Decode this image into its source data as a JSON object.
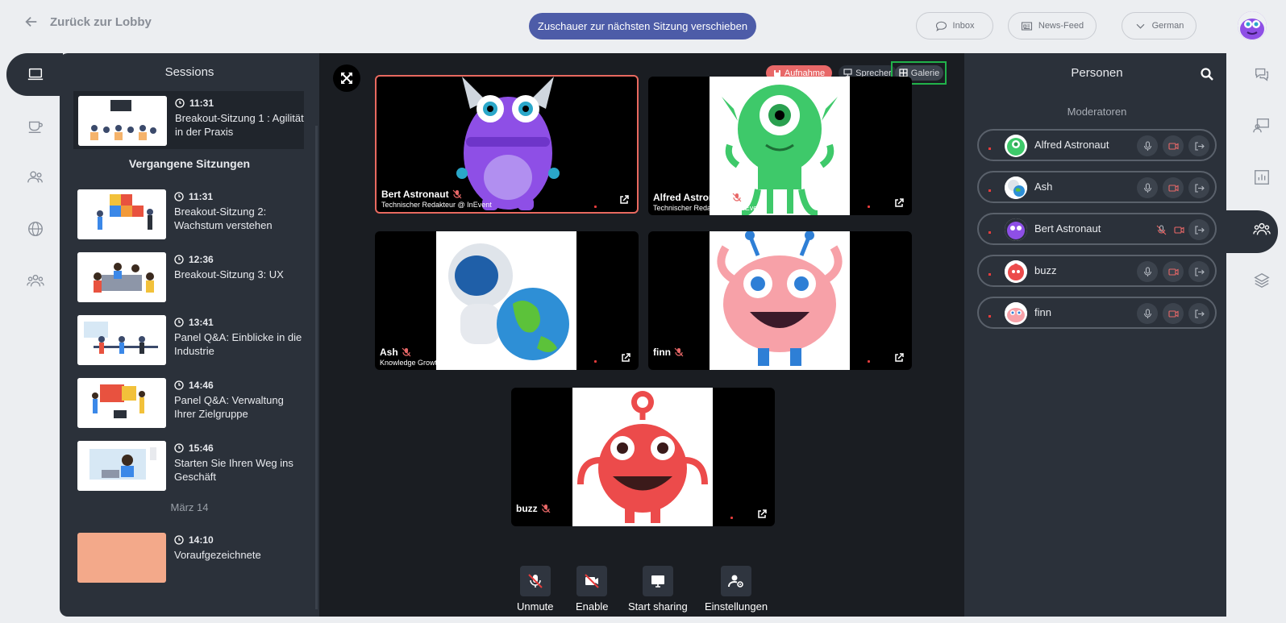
{
  "topbar": {
    "back_label": "Zurück zur Lobby",
    "move_button": "Zuschauer zur nächsten Sitzung verschieben",
    "inbox": "Inbox",
    "newsfeed": "News-Feed",
    "language": "German"
  },
  "sessions": {
    "title": "Sessions",
    "current": {
      "time": "11:31",
      "name": "Breakout-Sitzung 1 : Agilität in der Praxis"
    },
    "past_heading": "Vergangene Sitzungen",
    "past": [
      {
        "time": "11:31",
        "name": "Breakout-Sitzung 2: Wachstum verstehen"
      },
      {
        "time": "12:36",
        "name": "Breakout-Sitzung 3: UX"
      },
      {
        "time": "13:41",
        "name": "Panel Q&A: Einblicke in die Industrie"
      },
      {
        "time": "14:46",
        "name": "Panel Q&A: Verwaltung Ihrer Zielgruppe"
      },
      {
        "time": "15:46",
        "name": "Starten Sie Ihren Weg ins Geschäft"
      }
    ],
    "date_label": "März 14",
    "later": {
      "time": "14:10",
      "name": "Voraufgezeichnete"
    }
  },
  "stage": {
    "record": "Aufnahme",
    "speaker": "Sprecher",
    "gallery": "Galerie",
    "tiles": [
      {
        "name": "Bert Astronaut",
        "role": "Technischer Redakteur @ InEvent"
      },
      {
        "name": "Alfred Astronaut",
        "role": "Technischer Redakteur @ InEvent"
      },
      {
        "name": "Ash",
        "role": "Knowledge Growth specialist German @ InEvent"
      },
      {
        "name": "finn",
        "role": ""
      },
      {
        "name": "buzz",
        "role": ""
      }
    ],
    "controls": {
      "unmute": "Unmute",
      "enable": "Enable",
      "share": "Start sharing",
      "settings": "Einstellungen"
    }
  },
  "people": {
    "title": "Personen",
    "moderators_label": "Moderatoren",
    "list": [
      "Alfred Astronaut",
      "Ash",
      "Bert Astronaut",
      "buzz",
      "finn"
    ]
  },
  "colors": {
    "accent": "#4d5ca8",
    "record": "#e86868",
    "highlight": "#21b24a",
    "panel": "#2b313a"
  }
}
